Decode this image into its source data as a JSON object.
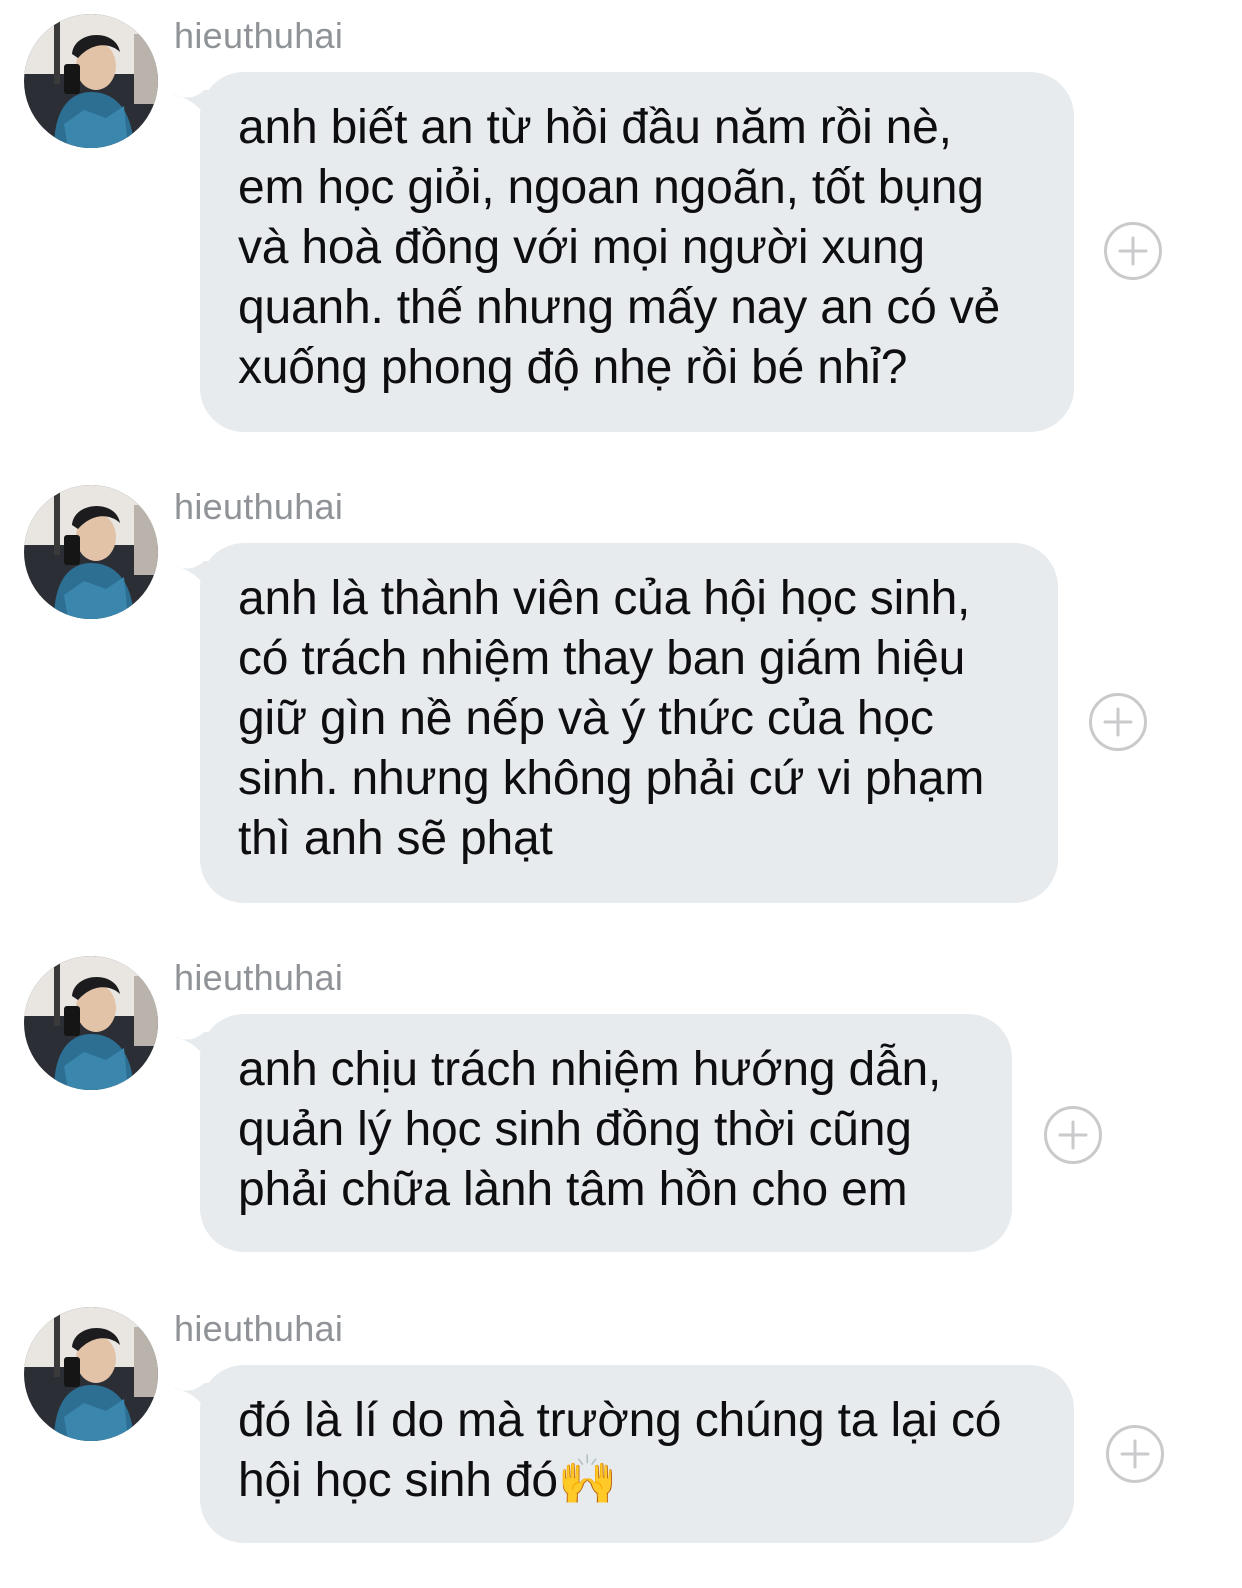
{
  "conversation": {
    "messages": [
      {
        "sender": "hieuthuhai",
        "text": "anh biết an từ hồi đầu năm rồi nè,\nem học giỏi, ngoan ngoãn, tốt bụng\nvà hoà đồng với mọi người xung\nquanh. thế nhưng mấy nay an có vẻ\nxuống phong độ nhẹ rồi bé nhỉ?"
      },
      {
        "sender": "hieuthuhai",
        "text": "anh là thành viên của hội học sinh,\ncó trách nhiệm thay ban giám hiệu\ngiữ gìn nề nếp và ý thức của học\nsinh. nhưng không phải cứ vi phạm\nthì anh sẽ phạt"
      },
      {
        "sender": "hieuthuhai",
        "text": "anh chịu trách nhiệm hướng dẫn,\nquản lý học sinh đồng thời cũng\nphải chữa lành tâm hồn cho em"
      },
      {
        "sender": "hieuthuhai",
        "text": "đó là lí do mà trường chúng ta lại có\nhội học sinh đó🙌"
      }
    ]
  },
  "colors": {
    "bubble": "#e7ebee",
    "sender_name": "#8f9296",
    "add_button_border": "#c8cacc",
    "text": "#0e0e10"
  },
  "icons": {
    "add": "plus-circle-icon"
  }
}
